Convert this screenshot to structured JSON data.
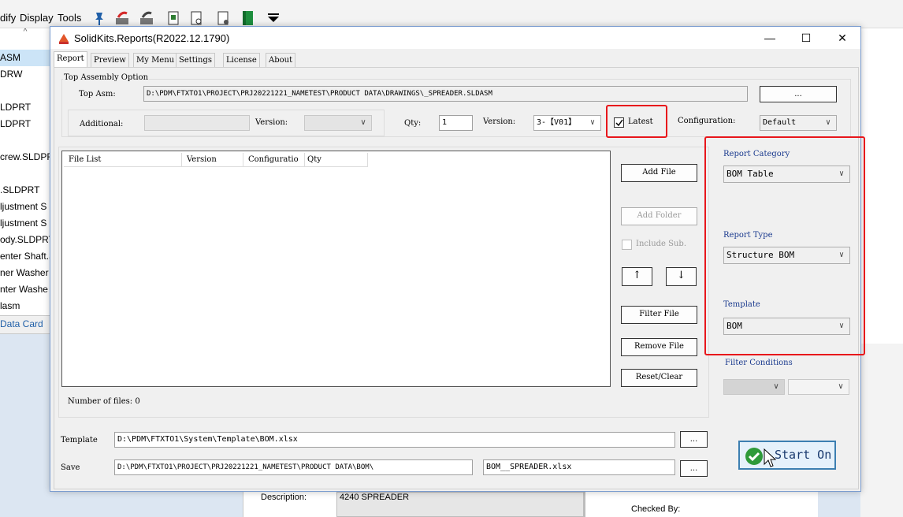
{
  "background_app": {
    "menu": [
      "dify",
      "Display",
      "Tools"
    ],
    "tree_items": [
      "ASM",
      "DRW",
      "",
      "LDPRT",
      "LDPRT",
      "",
      "crew.SLDPRT",
      "",
      ".SLDPRT",
      "ljustment S",
      "ljustment S",
      "ody.SLDPRT",
      "enter Shaft.S",
      "ner Washer",
      "nter Washe",
      "lasm"
    ],
    "tab_label": "Data Card",
    "description_label": "Description:",
    "description_value": "4240 SPREADER",
    "checked_by_label": "Checked By:"
  },
  "dialog": {
    "title": "SolidKits.Reports(R2022.12.1790)",
    "tabs": [
      "Report",
      "Preview",
      "My Menu",
      "Settings",
      "License",
      "About"
    ],
    "top_assembly": {
      "group_label": "Top Assembly Option",
      "top_asm_label": "Top Asm:",
      "top_asm_value": "D:\\PDM\\FTXTO1\\PROJECT\\PRJ20221221_NAMETEST\\PRODUCT DATA\\DRAWINGS\\_SPREADER.SLDASM",
      "browse_label": "...",
      "additional_label": "Additional:",
      "version_label": "Version:",
      "qty_label": "Qty:",
      "qty_value": "1",
      "version2_label": "Version:",
      "version2_value": "3-【V01】",
      "latest_label": "Latest",
      "configuration_label": "Configuration:",
      "configuration_value": "Default"
    },
    "file_list": {
      "columns": [
        "File List",
        "Version",
        "Configuratio",
        "Qty"
      ],
      "number_of_files": "Number of files: 0"
    },
    "buttons": {
      "add_file": "Add File",
      "add_folder": "Add Folder",
      "include_sub": "Include Sub.",
      "up": "↑",
      "down": "↓",
      "filter_file": "Filter File",
      "remove_file": "Remove File",
      "reset_clear": "Reset/Clear"
    },
    "report": {
      "category_label": "Report Category",
      "category_value": "BOM Table",
      "type_label": "Report Type",
      "type_value": "Structure BOM",
      "template_label": "Template",
      "template_value": "BOM",
      "filter_label": "Filter Conditions"
    },
    "bottom": {
      "template_label": "Template",
      "template_path": "D:\\PDM\\FTXTO1\\System\\Template\\BOM.xlsx",
      "template_browse": "...",
      "save_label": "Save",
      "save_path": "D:\\PDM\\FTXTO1\\PROJECT\\PRJ20221221_NAMETEST\\PRODUCT DATA\\BOM\\",
      "save_file": "BOM__SPREADER.xlsx",
      "save_browse": "..."
    },
    "start_button": "Start On"
  },
  "colors": {
    "highlight_red": "#e8161b",
    "start_green": "#2e9a3a",
    "label_blue": "#1a3a8e"
  }
}
